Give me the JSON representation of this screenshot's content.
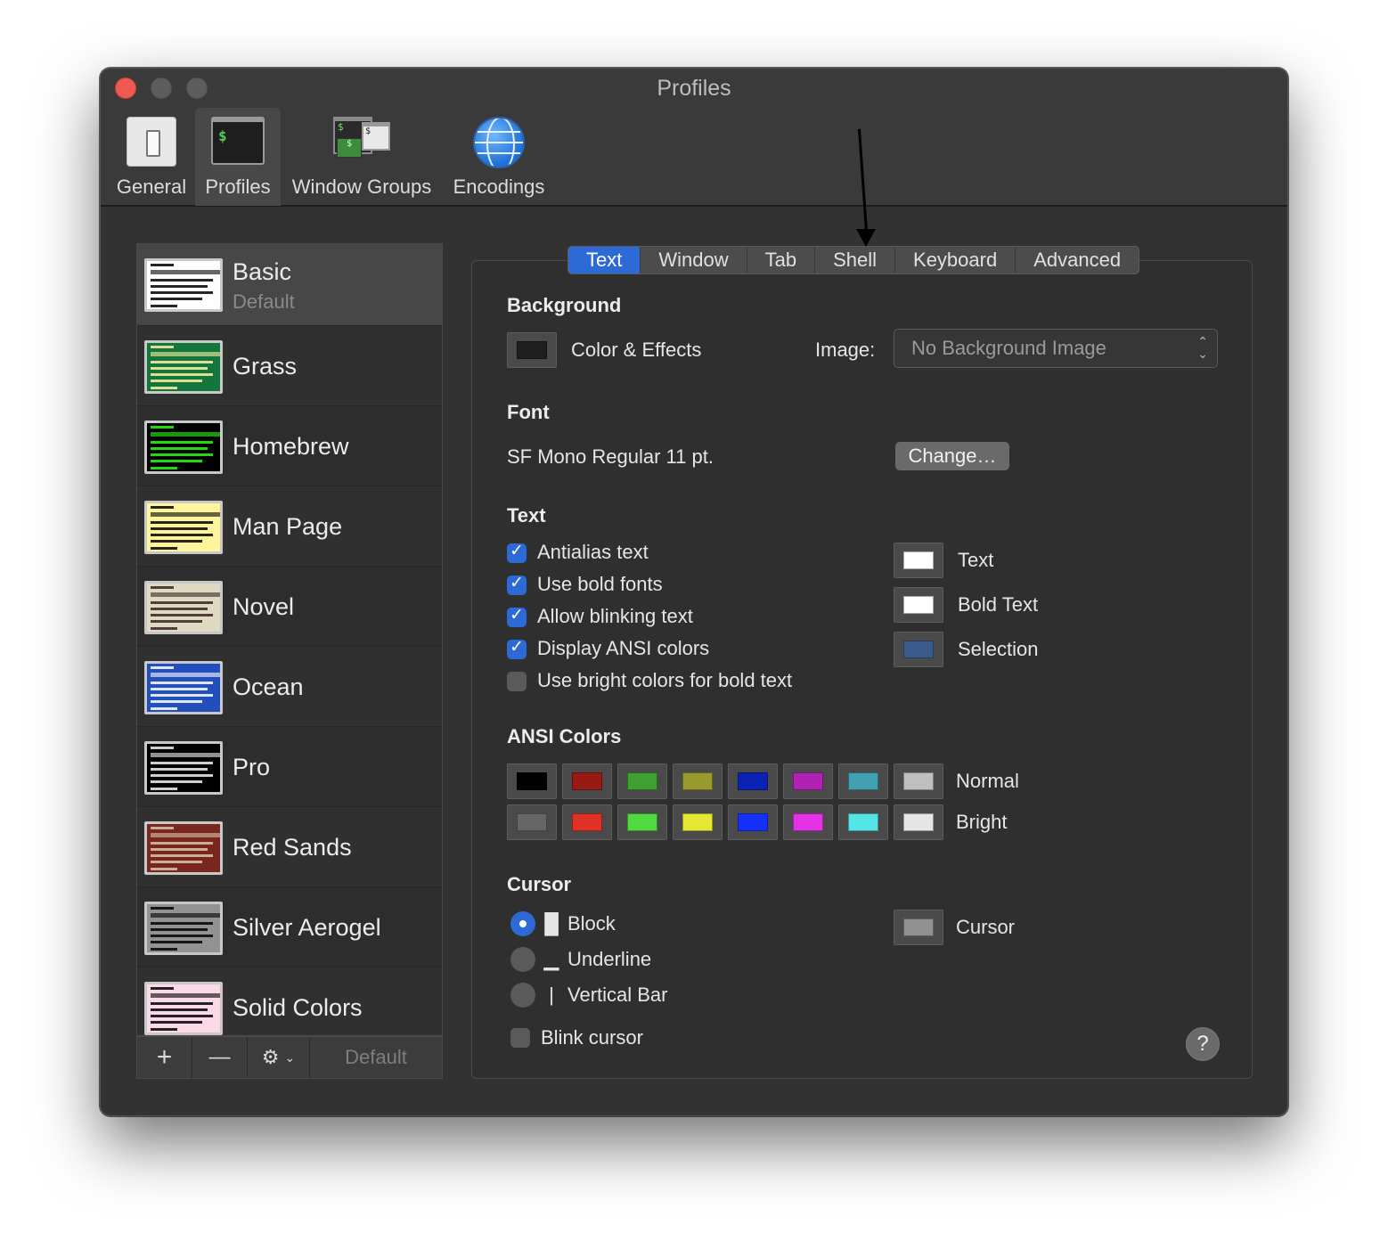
{
  "window": {
    "title": "Profiles"
  },
  "toolbar": [
    {
      "label": "General",
      "icon": "general-switch-icon"
    },
    {
      "label": "Profiles",
      "icon": "terminal-icon"
    },
    {
      "label": "Window Groups",
      "icon": "window-groups-icon"
    },
    {
      "label": "Encodings",
      "icon": "globe-icon"
    }
  ],
  "terminal_prompt": "$",
  "profiles": [
    {
      "name": "Basic",
      "subtitle": "Default",
      "bg": "#ffffff",
      "fg": "#000000"
    },
    {
      "name": "Grass",
      "bg": "#13773d",
      "fg": "#fff0a5"
    },
    {
      "name": "Homebrew",
      "bg": "#000000",
      "fg": "#28fe14"
    },
    {
      "name": "Man Page",
      "bg": "#fef49c",
      "fg": "#000000"
    },
    {
      "name": "Novel",
      "bg": "#dfdbc3",
      "fg": "#3b2322"
    },
    {
      "name": "Ocean",
      "bg": "#224fbc",
      "fg": "#ffffff"
    },
    {
      "name": "Pro",
      "bg": "#000000",
      "fg": "#f2f2f2"
    },
    {
      "name": "Red Sands",
      "bg": "#7a251e",
      "fg": "#d7c9a7"
    },
    {
      "name": "Silver Aerogel",
      "bg": "#929292",
      "fg": "#000000"
    },
    {
      "name": "Solid Colors",
      "bg": "#fbd9e8",
      "fg": "#000000"
    }
  ],
  "sidebar_footer": {
    "add": "+",
    "remove": "—",
    "gear": "⚙",
    "default": "Default"
  },
  "tabs": [
    "Text",
    "Window",
    "Tab",
    "Shell",
    "Keyboard",
    "Advanced"
  ],
  "active_tab": "Text",
  "background": {
    "title": "Background",
    "color_effects_label": "Color & Effects",
    "color": "#1e1e1e",
    "image_label": "Image:",
    "image_value": "No Background Image"
  },
  "font": {
    "title": "Font",
    "value": "SF Mono Regular 11 pt.",
    "change_label": "Change…"
  },
  "text": {
    "title": "Text",
    "checkboxes": [
      {
        "label": "Antialias text",
        "checked": true
      },
      {
        "label": "Use bold fonts",
        "checked": true
      },
      {
        "label": "Allow blinking text",
        "checked": true
      },
      {
        "label": "Display ANSI colors",
        "checked": true
      },
      {
        "label": "Use bright colors for bold text",
        "checked": false
      }
    ],
    "colors": [
      {
        "label": "Text",
        "color": "#ffffff"
      },
      {
        "label": "Bold Text",
        "color": "#ffffff"
      },
      {
        "label": "Selection",
        "color": "#3b5a8a"
      }
    ]
  },
  "ansi": {
    "title": "ANSI Colors",
    "normal_label": "Normal",
    "bright_label": "Bright",
    "normal": [
      "#000000",
      "#991a14",
      "#3fa131",
      "#999a2e",
      "#0b21b3",
      "#b022b3",
      "#42a0b3",
      "#bfbfbf"
    ],
    "bright": [
      "#666666",
      "#e03126",
      "#50d940",
      "#e6e635",
      "#1530fb",
      "#e433e6",
      "#54e6e6",
      "#e6e6e6"
    ]
  },
  "cursor": {
    "title": "Cursor",
    "options": [
      {
        "label": "Block",
        "glyph": "█",
        "selected": true
      },
      {
        "label": "Underline",
        "glyph": "▁",
        "selected": false
      },
      {
        "label": "Vertical Bar",
        "glyph": "|",
        "selected": false
      }
    ],
    "blink_label": "Blink cursor",
    "blink": false,
    "color_label": "Cursor",
    "color": "#919191"
  },
  "help_label": "?"
}
